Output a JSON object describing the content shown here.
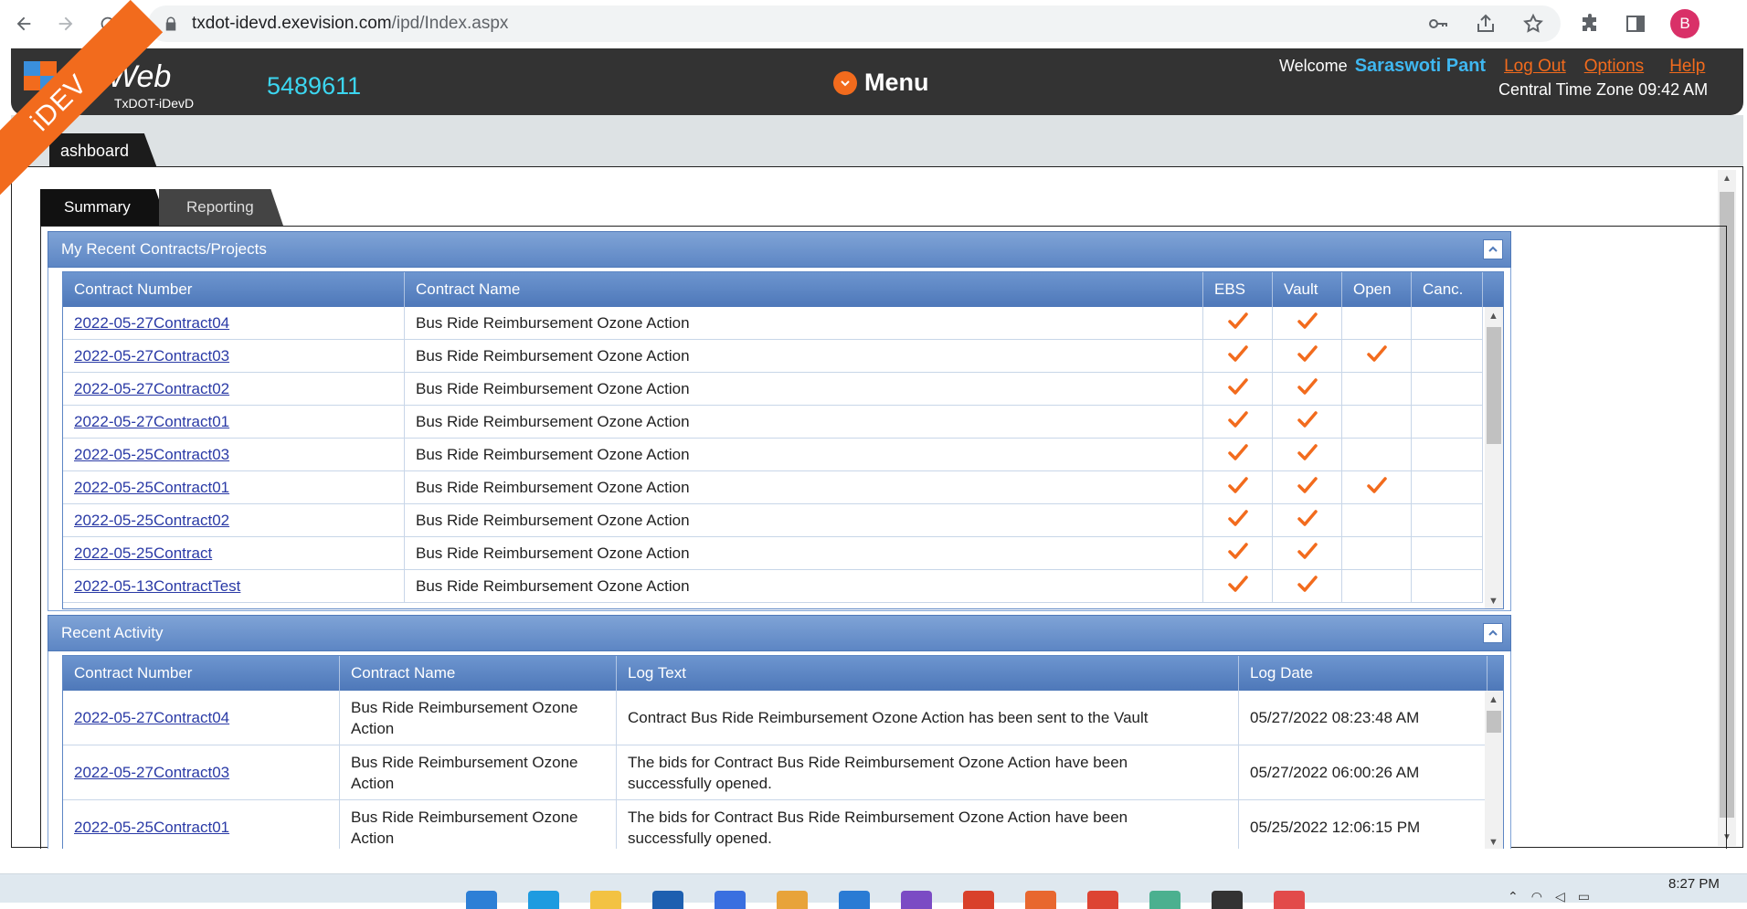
{
  "browser": {
    "url_host": "txdot-idevd.exevision.com",
    "url_path": "/ipd/Index.aspx",
    "profile_initial": "B"
  },
  "header": {
    "logo_text": "Web",
    "logo_sub": "TxDOT-iDevD",
    "contract_count": "5489611",
    "menu_label": "Menu",
    "welcome_label": "Welcome",
    "user_name": "Saraswoti Pant",
    "logout_label": "Log Out",
    "options_label": "Options",
    "help_label": "Help",
    "timezone": "Central Time Zone 09:42 AM",
    "ribbon": "iDEV"
  },
  "main_tab": "ashboard",
  "sub_tabs": [
    "Summary",
    "Reporting"
  ],
  "recent_contracts": {
    "title": "My Recent Contracts/Projects",
    "columns": [
      "Contract Number",
      "Contract Name",
      "EBS",
      "Vault",
      "Open",
      "Canc."
    ],
    "rows": [
      {
        "number": "2022-05-27Contract04",
        "name": "Bus Ride Reimbursement Ozone Action",
        "ebs": true,
        "vault": true,
        "open": false,
        "canc": false
      },
      {
        "number": "2022-05-27Contract03",
        "name": "Bus Ride Reimbursement Ozone Action",
        "ebs": true,
        "vault": true,
        "open": true,
        "canc": false
      },
      {
        "number": "2022-05-27Contract02",
        "name": "Bus Ride Reimbursement Ozone Action",
        "ebs": true,
        "vault": true,
        "open": false,
        "canc": false
      },
      {
        "number": "2022-05-27Contract01",
        "name": "Bus Ride Reimbursement Ozone Action",
        "ebs": true,
        "vault": true,
        "open": false,
        "canc": false
      },
      {
        "number": "2022-05-25Contract03",
        "name": "Bus Ride Reimbursement Ozone Action",
        "ebs": true,
        "vault": true,
        "open": false,
        "canc": false
      },
      {
        "number": "2022-05-25Contract01",
        "name": "Bus Ride Reimbursement Ozone Action",
        "ebs": true,
        "vault": true,
        "open": true,
        "canc": false
      },
      {
        "number": "2022-05-25Contract02",
        "name": "Bus Ride Reimbursement Ozone Action",
        "ebs": true,
        "vault": true,
        "open": false,
        "canc": false
      },
      {
        "number": "2022-05-25Contract",
        "name": "Bus Ride Reimbursement Ozone Action",
        "ebs": true,
        "vault": true,
        "open": false,
        "canc": false
      },
      {
        "number": "2022-05-13ContractTest",
        "name": "Bus Ride Reimbursement Ozone Action",
        "ebs": true,
        "vault": true,
        "open": false,
        "canc": false
      }
    ]
  },
  "recent_activity": {
    "title": "Recent Activity",
    "columns": [
      "Contract Number",
      "Contract Name",
      "Log Text",
      "Log Date"
    ],
    "rows": [
      {
        "number": "2022-05-27Contract04",
        "name": "Bus Ride Reimbursement Ozone Action",
        "log": "Contract Bus Ride Reimbursement Ozone Action has been sent to the Vault",
        "date": "05/27/2022 08:23:48 AM"
      },
      {
        "number": "2022-05-27Contract03",
        "name": "Bus Ride Reimbursement Ozone Action",
        "log": "The bids for Contract Bus Ride Reimbursement Ozone Action have been successfully opened.",
        "date": "05/27/2022 06:00:26 AM"
      },
      {
        "number": "2022-05-25Contract01",
        "name": "Bus Ride Reimbursement Ozone Action",
        "log": "The bids for Contract Bus Ride Reimbursement Ozone Action have been successfully opened.",
        "date": "05/25/2022 12:06:15 PM"
      }
    ]
  },
  "taskbar": {
    "clock": "8:27 PM"
  },
  "colors": {
    "accent_orange": "#f26b1d",
    "header_dark": "#333333",
    "grid_blue": "#5d86c4",
    "link_blue": "#2a3aa6"
  }
}
